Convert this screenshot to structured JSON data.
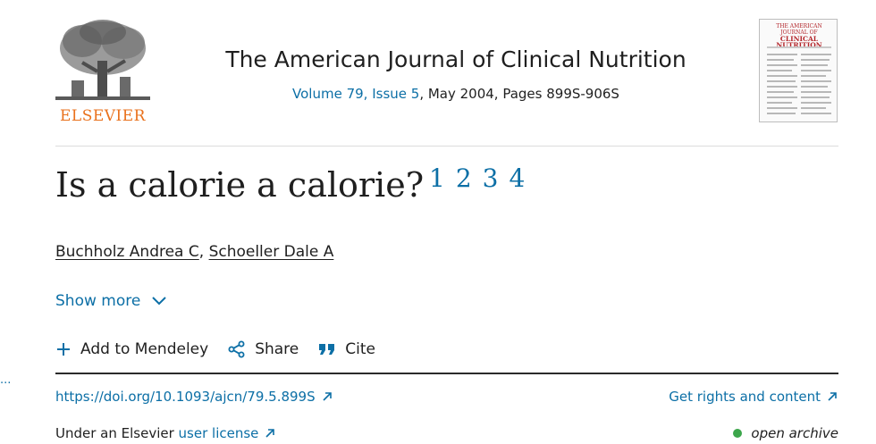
{
  "header": {
    "publisher": "ELSEVIER",
    "journal_title": "The American Journal of Clinical Nutrition",
    "volume_issue": "Volume 79, Issue 5",
    "date_pages": ", May 2004, Pages 899S-906S",
    "cover": {
      "top_text": "THE AMERICAN JOURNAL OF",
      "title": "CLINICAL NUTRITION"
    }
  },
  "article": {
    "title": "Is a calorie a calorie?",
    "footnotes": [
      "1",
      "2",
      "3",
      "4"
    ],
    "authors": [
      "Buchholz Andrea C",
      "Schoeller Dale A"
    ],
    "author_separator": ",",
    "show_more": "Show more"
  },
  "toolbar": {
    "mendeley": "Add to Mendeley",
    "share": "Share",
    "cite": "Cite"
  },
  "links": {
    "doi": "https://doi.org/10.1093/ajcn/79.5.899S",
    "rights": "Get rights and content",
    "license_prefix": "Under an Elsevier ",
    "license_link": "user license",
    "access": "open archive"
  },
  "left_marker": "...",
  "colors": {
    "link": "#0c6fa6",
    "brand": "#e9711c",
    "open_access": "#3ca64b"
  }
}
